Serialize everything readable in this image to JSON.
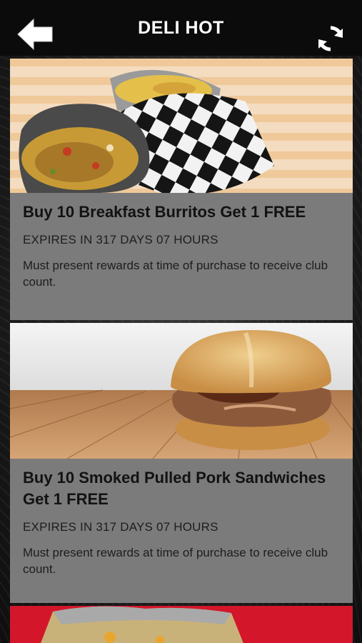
{
  "header": {
    "title": "DELI HOT",
    "back_icon": "back-arrow-icon",
    "refresh_icon": "refresh-icon"
  },
  "colors": {
    "header_bg": "#0b0b0b",
    "card_bg": "#7b7b7b",
    "promo_red": "#d3162a"
  },
  "rewards": [
    {
      "title": "Buy 10 Breakfast Burritos Get 1 FREE",
      "expiry": "EXPIRES IN 317 DAYS 07 HOURS",
      "description": "Must present rewards at time of purchase to receive club count."
    },
    {
      "title": "Buy 10 Smoked Pulled Pork Sandwiches Get 1 FREE",
      "expiry": "EXPIRES IN 317 DAYS 07 HOURS",
      "description": "Must present rewards at time of purchase to receive club count."
    }
  ]
}
